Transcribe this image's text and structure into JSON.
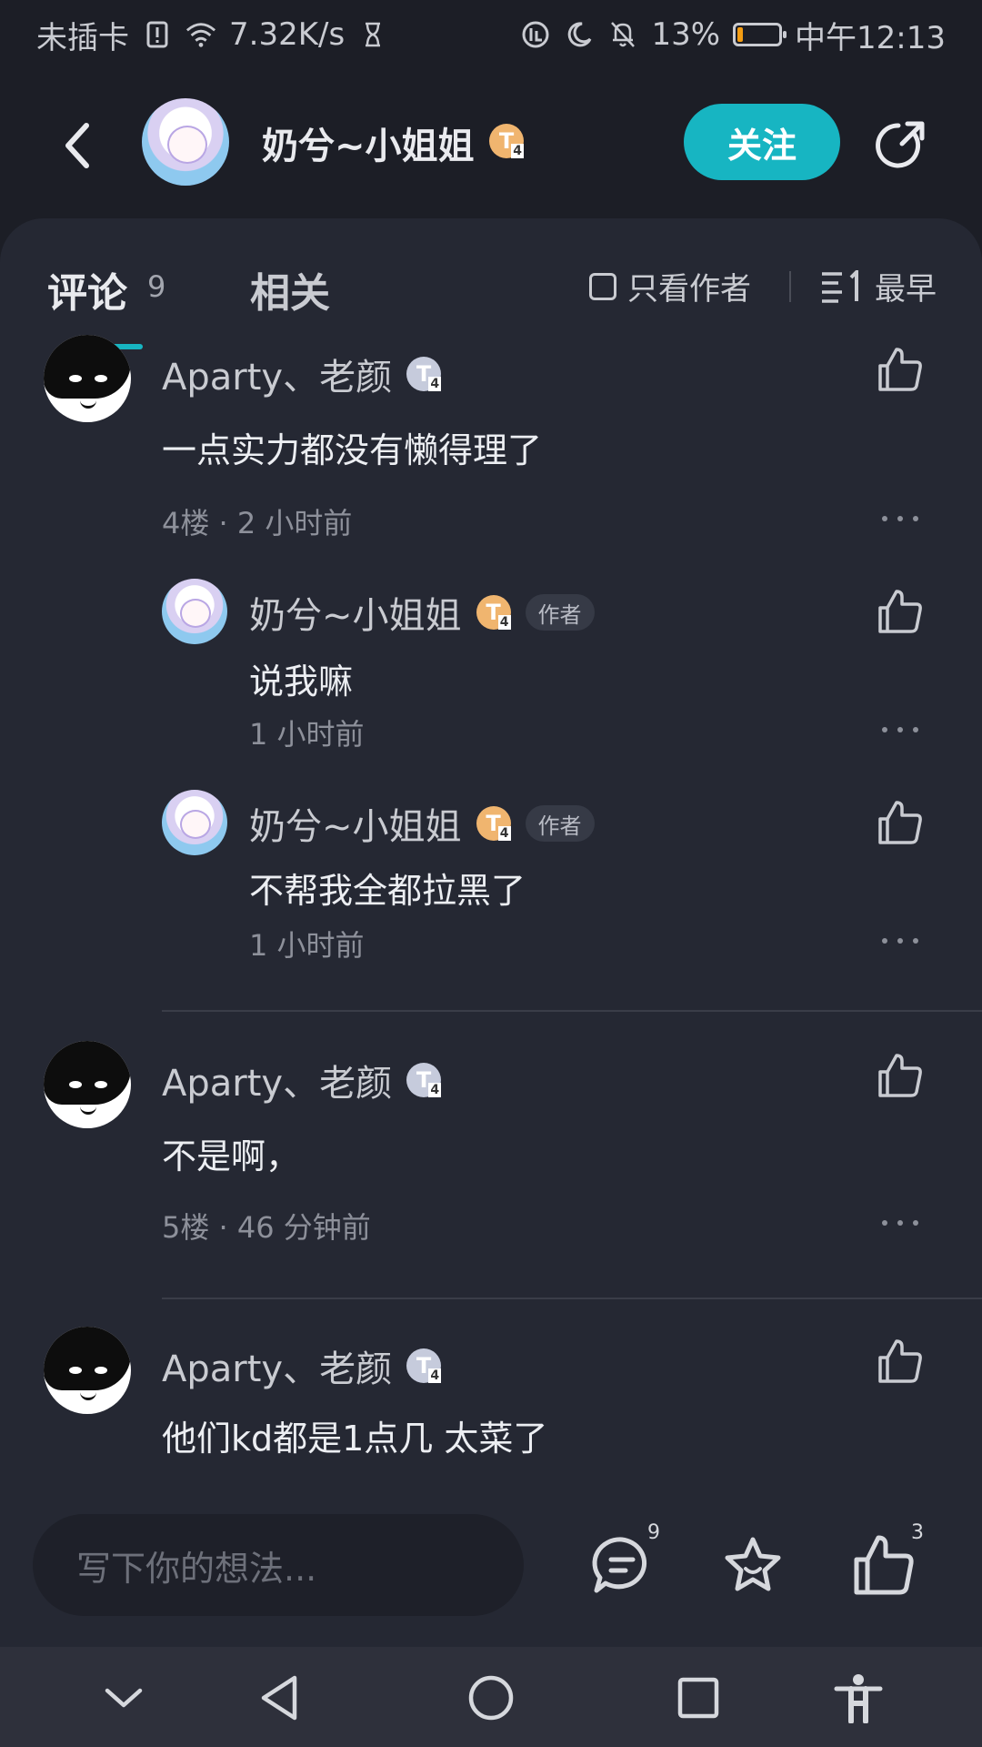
{
  "status_bar": {
    "carrier": "未插卡",
    "speed": "7.32K/s",
    "battery": "13%",
    "battery_level": 0.13,
    "time": "中午12:13"
  },
  "header": {
    "username": "奶兮~小姐姐",
    "level_badge": "T",
    "level_sub": "4",
    "follow_label": "关注"
  },
  "tabs": {
    "comments_label": "评论",
    "comments_count": "9",
    "related_label": "相关",
    "author_only_label": "只看作者",
    "sort_label": "最早"
  },
  "comments": [
    {
      "author": "Aparty、老颜",
      "badge": "T",
      "badge_sub": "4",
      "text": "一点实力都没有懒得理了",
      "meta": "4楼 · 2 小时前",
      "replies": [
        {
          "author": "奶兮~小姐姐",
          "badge": "T",
          "badge_sub": "4",
          "tag": "作者",
          "text": "说我嘛",
          "meta": "1 小时前"
        },
        {
          "author": "奶兮~小姐姐",
          "badge": "T",
          "badge_sub": "4",
          "tag": "作者",
          "text": "不帮我全都拉黑了",
          "meta": "1 小时前"
        }
      ]
    },
    {
      "author": "Aparty、老颜",
      "badge": "T",
      "badge_sub": "4",
      "text": "不是啊，",
      "meta": "5楼 · 46 分钟前"
    },
    {
      "author": "Aparty、老颜",
      "badge": "T",
      "badge_sub": "4",
      "text": "他们kd都是1点几  太菜了"
    }
  ],
  "bottom_bar": {
    "input_placeholder": "写下你的想法...",
    "comment_count": "9",
    "like_count": "3"
  },
  "icons": {
    "accent": "#17b5c2",
    "badge_gold": "#f0b56f",
    "badge_silver": "#c6cbdc"
  }
}
